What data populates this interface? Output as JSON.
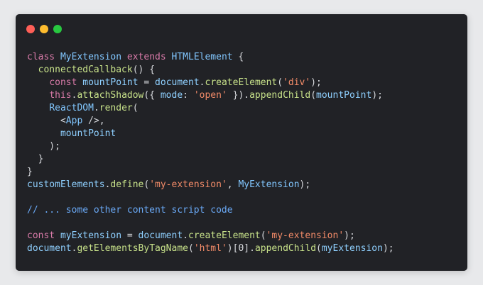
{
  "colors": {
    "background": "#e8e9eb",
    "window": "#212226",
    "dot_red": "#ff5f57",
    "dot_yellow": "#febc2e",
    "dot_green": "#28c840"
  },
  "code": {
    "lines": [
      "class MyExtension extends HTMLElement {",
      "  connectedCallback() {",
      "    const mountPoint = document.createElement('div');",
      "    this.attachShadow({ mode: 'open' }).appendChild(mountPoint);",
      "    ReactDOM.render(",
      "      <App />,",
      "      mountPoint",
      "    );",
      "  }",
      "}",
      "customElements.define('my-extension', MyExtension);",
      "",
      "// ... some other content script code",
      "",
      "const myExtension = document.createElement('my-extension');",
      "document.getElementsByTagName('html')[0].appendChild(myExtension);"
    ]
  }
}
